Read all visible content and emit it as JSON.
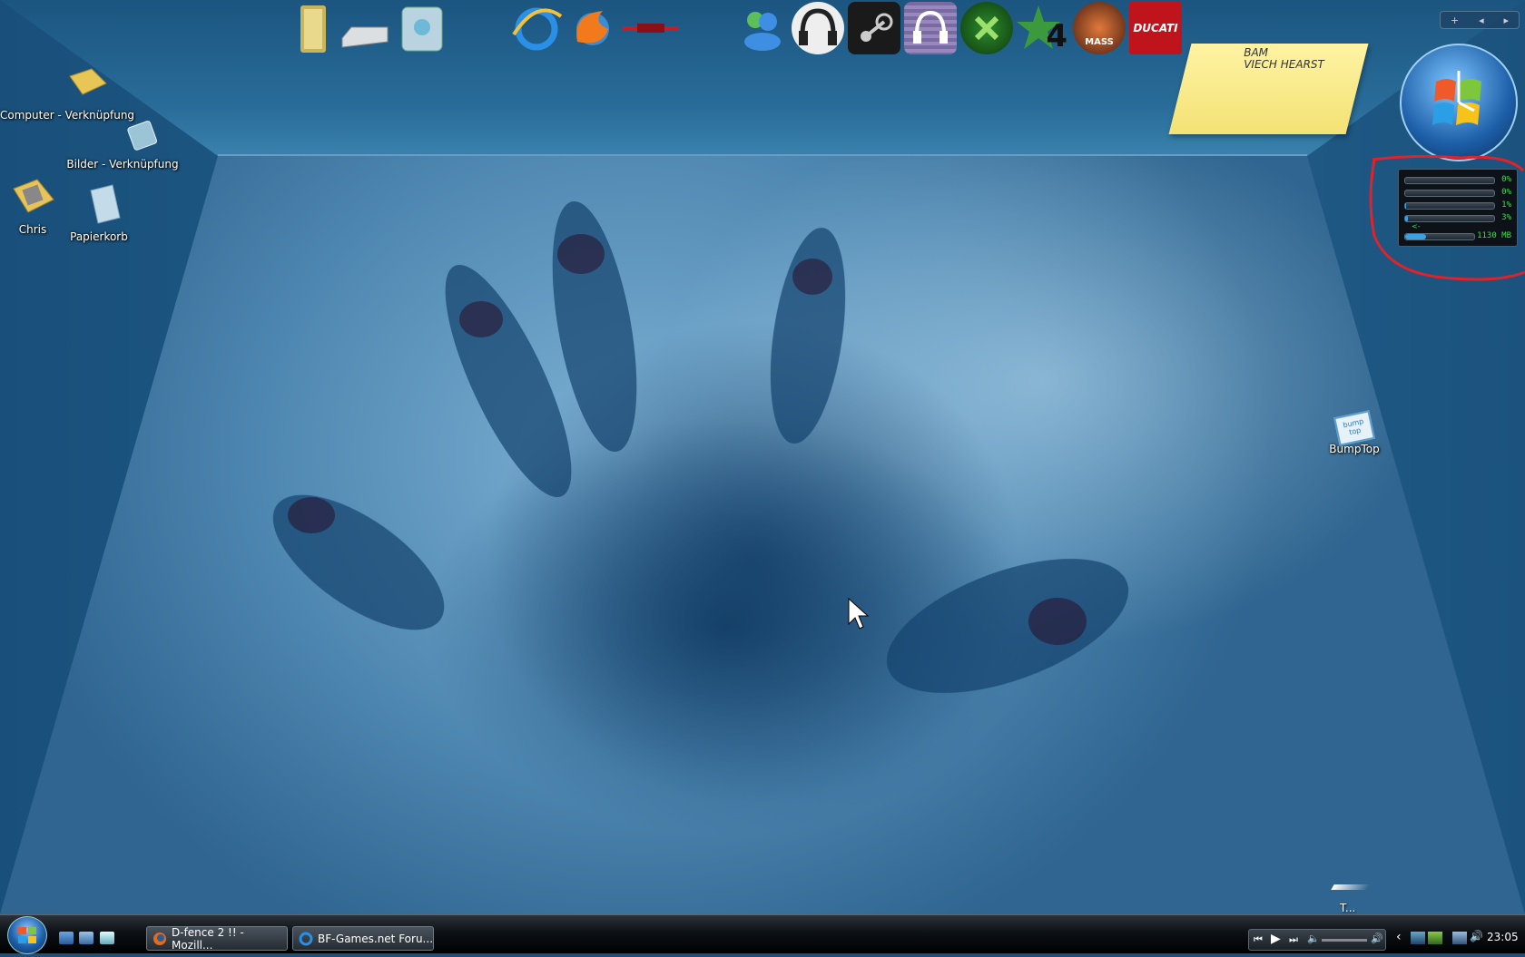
{
  "dock": {
    "icons": [
      "folder-icon",
      "drive-icon",
      "network-drive-icon",
      "internet-explorer-icon",
      "browser-flame-icon",
      "red-logo-icon",
      "messenger-icon",
      "headphones-icon",
      "steam-icon",
      "audio-headphones-icon",
      "xbox-icon",
      "star-4-icon",
      "mass-effect-icon",
      "ducati-icon"
    ],
    "star_text": "4",
    "mass_text": "MASS",
    "ducati_text": "DUCATI"
  },
  "desktop": {
    "computer_label": "Computer - Verknüpfung",
    "bilder_label": "Bilder - Verknüpfung",
    "chris_label": "Chris",
    "papierkorb_label": "Papierkorb",
    "bumptop_label": "BumpTop",
    "bumptop_logo": "bump top",
    "room_item_label": "T..."
  },
  "sticky_note": {
    "line1": "BAM",
    "line2": "VIECH HEARST"
  },
  "gadgets": {
    "toolbar_add": "+",
    "toolbar_prev": "◂",
    "toolbar_next": "▸"
  },
  "meter": {
    "rows": [
      {
        "value": "0%",
        "fill": 0.0
      },
      {
        "value": "0%",
        "fill": 0.0
      },
      {
        "value": "1%",
        "fill": 0.01
      },
      {
        "value": "3%",
        "fill": 0.03
      }
    ],
    "memory": "1130 MB",
    "memory_fill": 0.3,
    "arrow": "<-"
  },
  "taskbar": {
    "tasks": [
      {
        "label": "D-fence 2 !! - Mozill...",
        "icon": "firefox-icon"
      },
      {
        "label": "BF-Games.net Foru...",
        "icon": "internet-explorer-icon"
      }
    ],
    "tray_chevron": "‹",
    "clock": "23:05"
  },
  "colors": {
    "annotation_red": "#e0222a",
    "meter_green": "#3edc4e",
    "taskbar_dark": "#0d1116"
  }
}
